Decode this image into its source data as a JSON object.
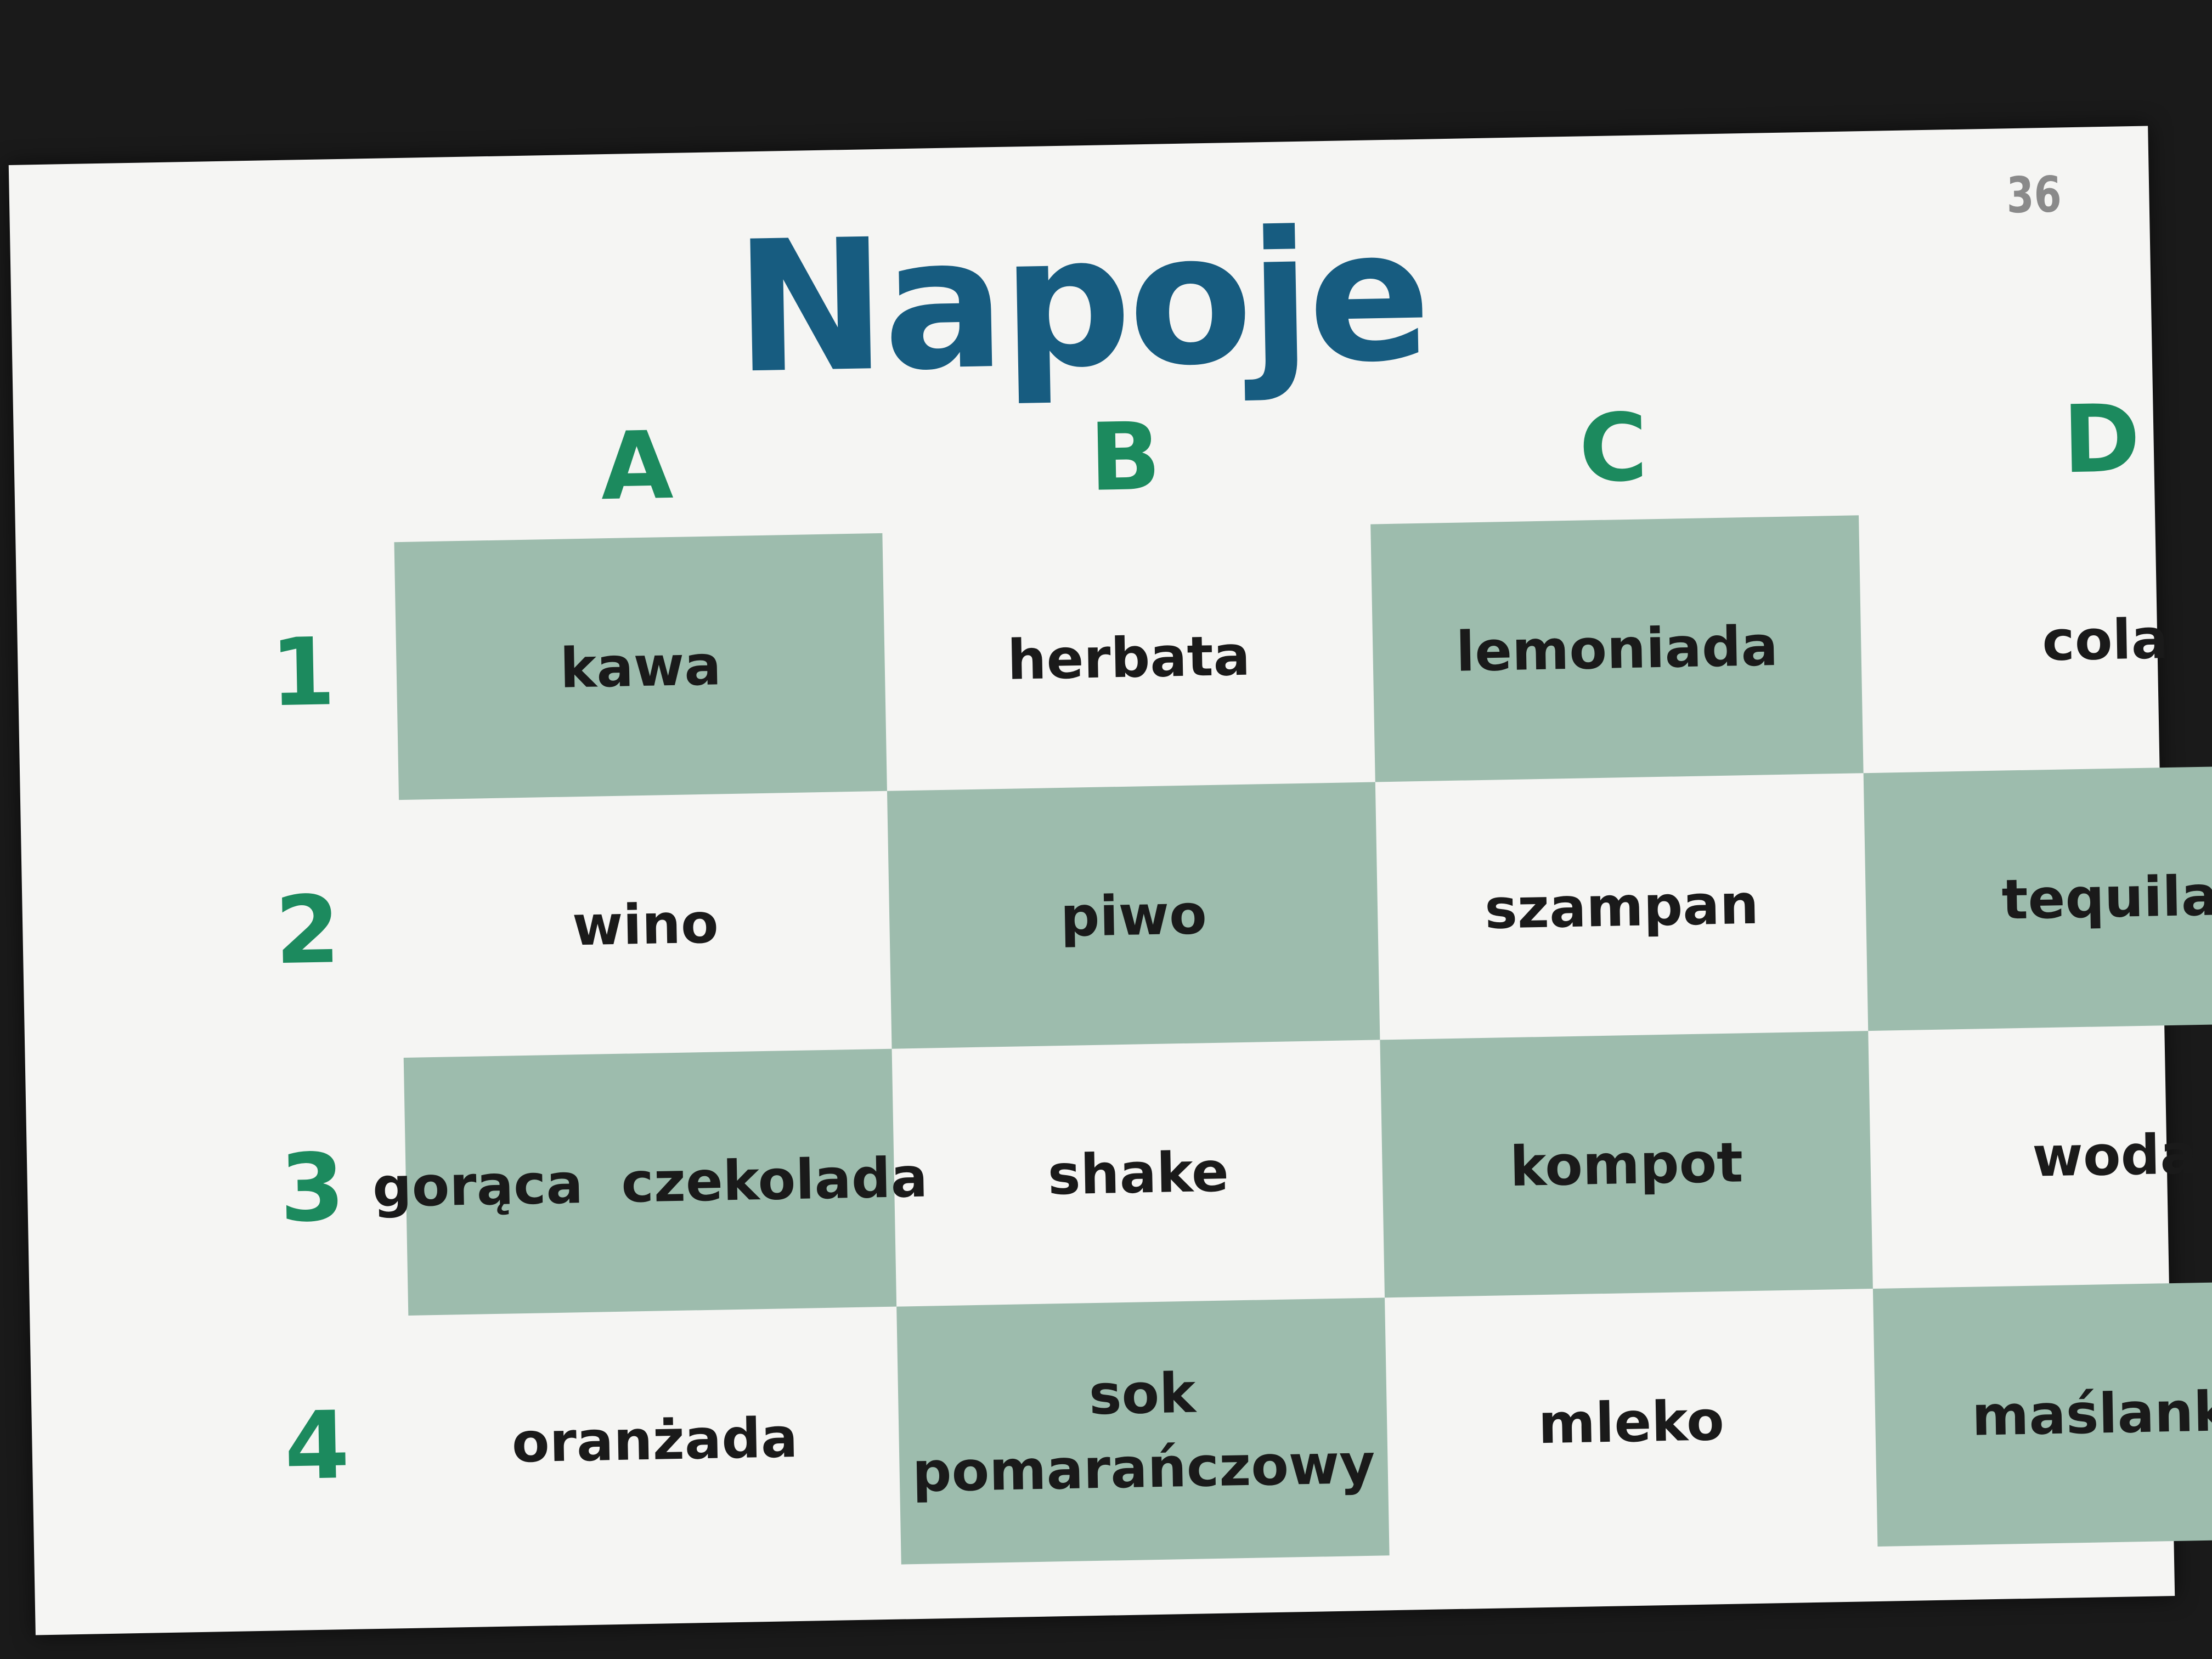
{
  "card": {
    "page_number": "36",
    "title": "Napoje",
    "columns": [
      "A",
      "B",
      "C",
      "D"
    ],
    "rows": [
      {
        "label": "1",
        "cells": [
          "kawa",
          "herbata",
          "lemoniada",
          "cola"
        ]
      },
      {
        "label": "2",
        "cells": [
          "wino",
          "piwo",
          "szampan",
          "tequila"
        ]
      },
      {
        "label": "3",
        "cells": [
          "gorąca  czekolada",
          "shake",
          "kompot",
          "woda"
        ]
      },
      {
        "label": "4",
        "cells": [
          "oranżada",
          "sok\npomarańczowy",
          "mleko",
          "maślanka"
        ]
      }
    ]
  },
  "colors": {
    "title": "#175c80",
    "headers": "#1c8a5e",
    "shaded_cell": "#9dbcad",
    "card": "#f5f5f3",
    "background": "#1a1a1a"
  }
}
